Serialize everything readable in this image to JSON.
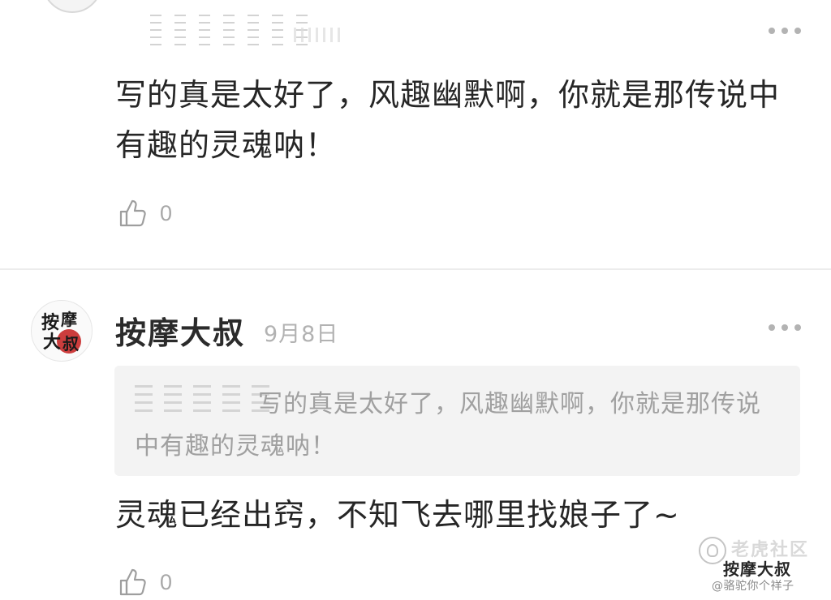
{
  "first_comment": {
    "text": "写的真是太好了，风趣幽默啊，你就是那传说中有趣的灵魂呐！",
    "like_count": "0",
    "more_icon": "ellipsis-icon",
    "like_icon": "thumbs-up-icon"
  },
  "second_comment": {
    "author": "按摩大叔",
    "avatar_text": "按摩大叔",
    "date": "9月8日",
    "quote_text": "写的真是太好了，风趣幽默啊，你就是那传说中有趣的灵魂呐！",
    "text": "灵魂已经出窍，不知飞去哪里找娘子了~",
    "like_count": "0",
    "more_icon": "ellipsis-icon",
    "like_icon": "thumbs-up-icon"
  },
  "watermark": {
    "line1": "老虎社区",
    "line2": "按摩大叔",
    "line3": "@骆驼你个祥子",
    "icon": "wechat-icon"
  },
  "colors": {
    "text": "#262626",
    "muted": "#a8a8a8",
    "quote_bg": "#f3f3f3",
    "divider": "#ececec",
    "seal_red": "#c62828"
  }
}
